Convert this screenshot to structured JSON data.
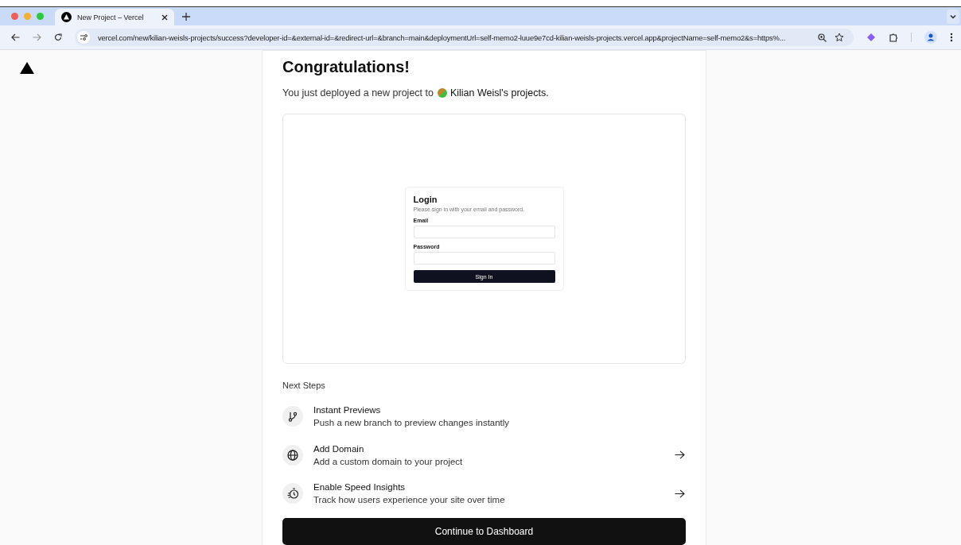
{
  "browser": {
    "tab": {
      "title": "New Project – Vercel",
      "selected": true
    },
    "address": "vercel.com/new/kilian-weisls-projects/success?developer-id=&external-id=&redirect-url=&branch=main&deploymentUrl=self-memo2-luue9e7cd-kilian-weisls-projects.vercel.app&projectName=self-memo2&s=https%..."
  },
  "heading": "Congratulations!",
  "message": {
    "text": "You just deployed a new project to",
    "team": "Kilian Weisl's projects."
  },
  "preview": {
    "title": "Login",
    "subtitle": "Please sign in with your email and password.",
    "fields": [
      {
        "label": "Email"
      },
      {
        "label": "Password"
      }
    ],
    "button": "Sign In"
  },
  "next_steps": {
    "title": "Next Steps",
    "items": [
      {
        "kind": "branch",
        "title": "Instant Previews",
        "description": "Push a new branch to preview changes instantly",
        "has_arrow": false
      },
      {
        "kind": "globe",
        "title": "Add Domain",
        "description": "Add a custom domain to your project",
        "has_arrow": true
      },
      {
        "kind": "speed",
        "title": "Enable Speed Insights",
        "description": "Track how users experience your site over time",
        "has_arrow": true
      }
    ]
  },
  "continue_button": "Continue to Dashboard"
}
